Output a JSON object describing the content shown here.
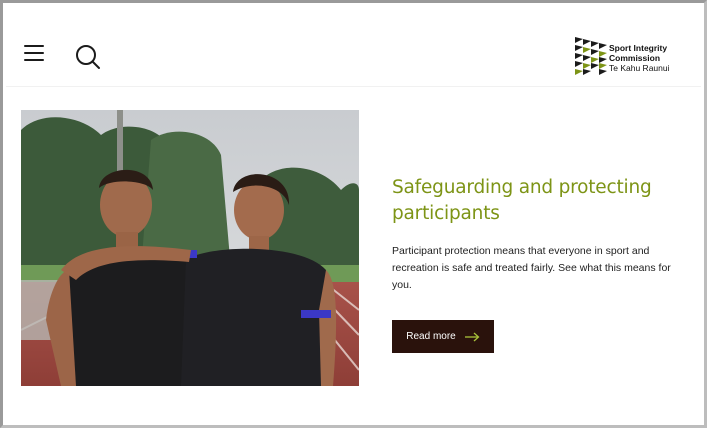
{
  "header": {
    "menu_icon": "hamburger-menu-icon",
    "search_icon": "search-icon",
    "logo": {
      "line1": "Sport Integrity",
      "line2": "Commission",
      "line3": "Te Kahu Raunui"
    }
  },
  "hero": {
    "image_description_icon": "photo-two-athletes-on-track"
  },
  "content": {
    "title": "Safeguarding and protecting participants",
    "description": "Participant protection means that everyone in sport and recreation is safe and treated fairly. See what this means for you.",
    "cta_label": "Read more"
  },
  "colors": {
    "title": "#7d9416",
    "cta_background": "#2a120c",
    "cta_arrow": "#a8c23a"
  }
}
